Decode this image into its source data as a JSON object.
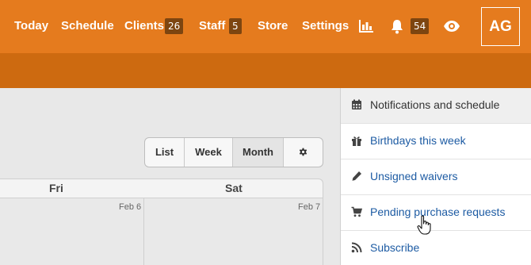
{
  "nav": {
    "today": "Today",
    "schedule": "Schedule",
    "clients": "Clients",
    "clients_count": "26",
    "staff": "Staff",
    "staff_count": "5",
    "store": "Store",
    "settings": "Settings",
    "notifications_count": "54",
    "avatar_initials": "AG"
  },
  "calendar": {
    "views": [
      "List",
      "Week",
      "Month"
    ],
    "active_view": "Month",
    "days": [
      "Fri",
      "Sat"
    ],
    "dates": [
      "Feb 6",
      "Feb 7"
    ]
  },
  "menu": {
    "items": [
      {
        "label": "Notifications and schedule",
        "icon": "calendar-icon"
      },
      {
        "label": "Birthdays this week",
        "icon": "gift-icon"
      },
      {
        "label": "Unsigned waivers",
        "icon": "pencil-icon"
      },
      {
        "label": "Pending purchase requests",
        "icon": "cart-icon"
      },
      {
        "label": "Subscribe",
        "icon": "rss-icon"
      }
    ]
  },
  "colors": {
    "topbar": "#e57b1e",
    "subbar": "#cd6a10",
    "badge": "#7d4510",
    "link": "#1d5ba3"
  }
}
